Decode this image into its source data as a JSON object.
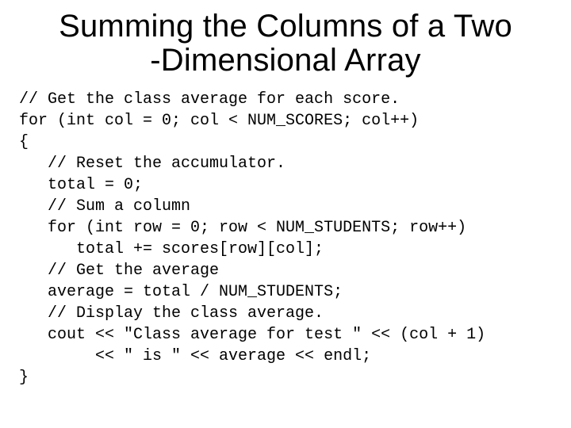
{
  "title_line1": "Summing the Columns of a Two",
  "title_line2": "-Dimensional Array",
  "code": {
    "l01": "// Get the class average for each score.",
    "l02": "for (int col = 0; col < NUM_SCORES; col++)",
    "l03": "{",
    "l04": "   // Reset the accumulator.",
    "l05": "   total = 0;",
    "l06": "   // Sum a column",
    "l07": "   for (int row = 0; row < NUM_STUDENTS; row++)",
    "l08": "      total += scores[row][col];",
    "l09": "   // Get the average",
    "l10": "   average = total / NUM_STUDENTS;",
    "l11": "   // Display the class average.",
    "l12": "   cout << \"Class average for test \" << (col + 1)",
    "l13": "        << \" is \" << average << endl;",
    "l14": "}"
  }
}
